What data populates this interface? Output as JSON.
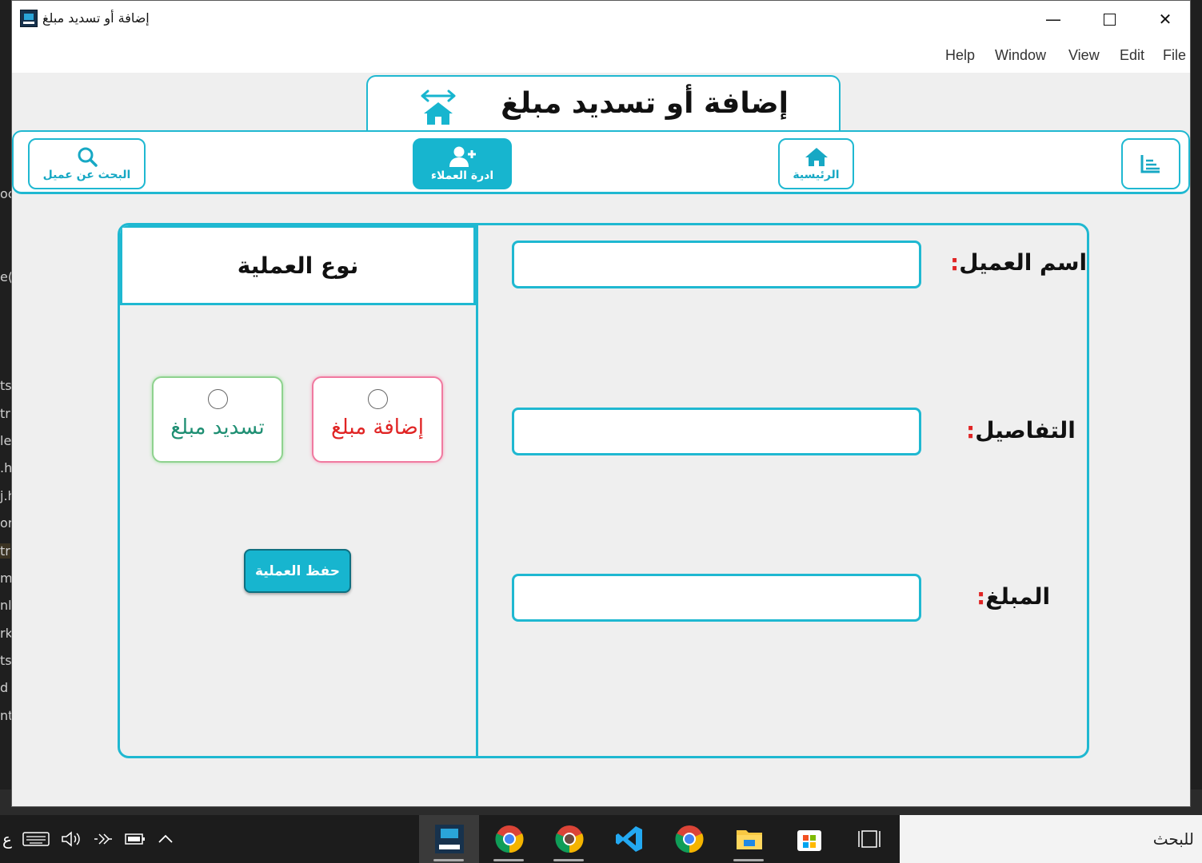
{
  "window": {
    "title": "إضافة أو تسديد مبلغ",
    "minimize_glyph": "—",
    "close_glyph": "✕"
  },
  "menu": {
    "items": [
      "File",
      "Edit",
      "View",
      "Window",
      "Help"
    ]
  },
  "page": {
    "title": "إضافة أو تسديد مبلغ",
    "title_icon": "house-arrows-icon"
  },
  "nav": {
    "search_label": "البحث عن عميل",
    "clients_label": "ادرة العملاء",
    "home_label": "الرئيسية",
    "active_item": "clients"
  },
  "form": {
    "client_name_label": "اسم العميل",
    "details_label": "التفاصيل",
    "amount_label": "المبلغ",
    "colon": ":",
    "client_name_value": "",
    "details_value": "",
    "amount_value": ""
  },
  "operation": {
    "header": "نوع العملية",
    "add_option": "إضافة مبلغ",
    "pay_option": "تسديد مبلغ",
    "save_label": "حفظ العملية"
  },
  "taskbar": {
    "search_text": "للبحث"
  },
  "colors": {
    "accent": "#1fb8d1",
    "add_text": "#e02424",
    "pay_text": "#1f8f73"
  }
}
